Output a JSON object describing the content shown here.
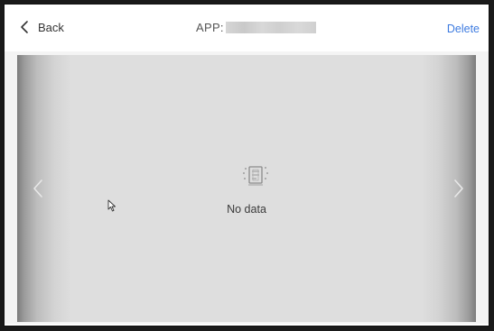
{
  "header": {
    "back_label": "Back",
    "title_prefix": "APP:",
    "delete_label": "Delete",
    "delete_color": "#3d7be0"
  },
  "content": {
    "empty_text": "No data",
    "empty_icon": "empty-document-icon",
    "prev_icon": "chevron-left-icon",
    "next_icon": "chevron-right-icon"
  }
}
